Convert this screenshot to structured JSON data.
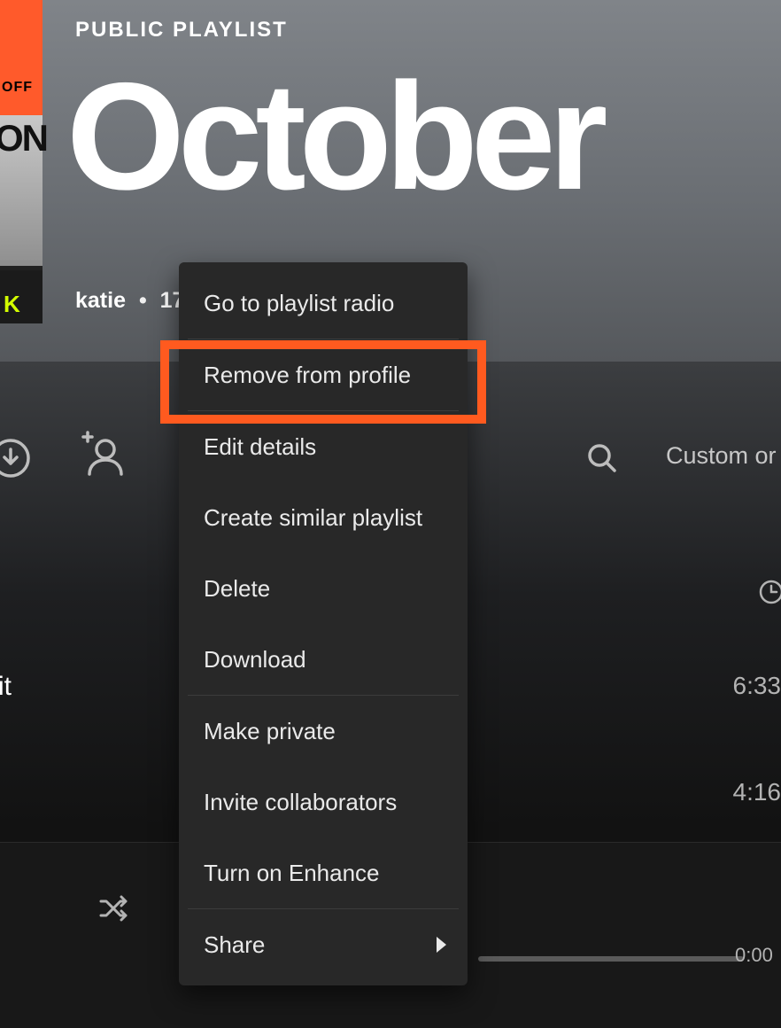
{
  "header": {
    "playlist_type": "PUBLIC PLAYLIST",
    "playlist_title": "October",
    "owner": "katie",
    "song_count_fragment": "17",
    "art_off": "OFF",
    "art_on": "ON",
    "art_k": "K"
  },
  "toolbar": {
    "sort_label": "Custom or"
  },
  "tracks": [
    {
      "title_fragment": "it",
      "duration": "6:33"
    },
    {
      "title_fragment": "",
      "duration": "4:16"
    }
  ],
  "now_playing": {
    "elapsed": "0:00"
  },
  "context_menu": {
    "items": [
      "Go to playlist radio",
      "Remove from profile",
      "Edit details",
      "Create similar playlist",
      "Delete",
      "Download",
      "Make private",
      "Invite collaborators",
      "Turn on Enhance",
      "Share"
    ]
  }
}
